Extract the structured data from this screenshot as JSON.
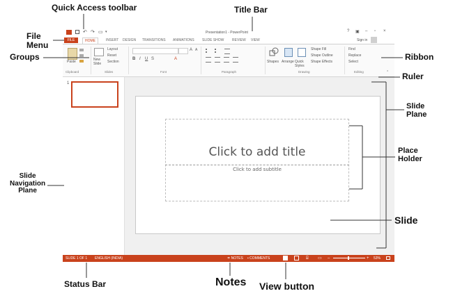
{
  "callouts": {
    "quick_access": "Quick Access toolbar",
    "title_bar": "Title Bar",
    "file_menu": "File\nMenu",
    "groups": "Groups",
    "ribbon": "Ribbon",
    "ruler": "Ruler",
    "slide_plane": "Slide\nPlane",
    "place_holder": "Place\nHolder",
    "slide_navigation": "Slide\nNavigation\nPlane",
    "slide": "Slide",
    "status_bar": "Status Bar",
    "notes": "Notes",
    "view_button": "View button"
  },
  "window": {
    "title": "Presentation1 - PowerPoint",
    "sign_in": "Sign in",
    "tabs": [
      "FILE",
      "HOME",
      "INSERT",
      "DESIGN",
      "TRANSITIONS",
      "ANIMATIONS",
      "SLIDE SHOW",
      "REVIEW",
      "VIEW"
    ],
    "group_labels": [
      "Clipboard",
      "Slides",
      "Font",
      "Paragraph",
      "Drawing",
      "Editing"
    ],
    "ribbon_buttons": {
      "paste": "Paste",
      "new_slide": "New Slide",
      "layout": "Layout",
      "reset": "Reset",
      "section": "Section",
      "shapes": "Shapes",
      "arrange": "Arrange",
      "quick_styles": "Quick Styles",
      "shape_fill": "Shape Fill",
      "shape_outline": "Shape Outline",
      "shape_effects": "Shape Effects",
      "find": "Find",
      "replace": "Replace",
      "select": "Select"
    },
    "slide_thumbnail_number": "1",
    "title_placeholder": "Click to add title",
    "subtitle_placeholder": "Click to add subtitle",
    "status": {
      "slide_of": "SLIDE 1 OF 1",
      "language": "ENGLISH (INDIA)",
      "notes": "NOTES",
      "comments": "COMMENTS",
      "zoom": "53%"
    }
  },
  "colors": {
    "accent": "#c9421c",
    "file_tab": "#c9421c"
  }
}
